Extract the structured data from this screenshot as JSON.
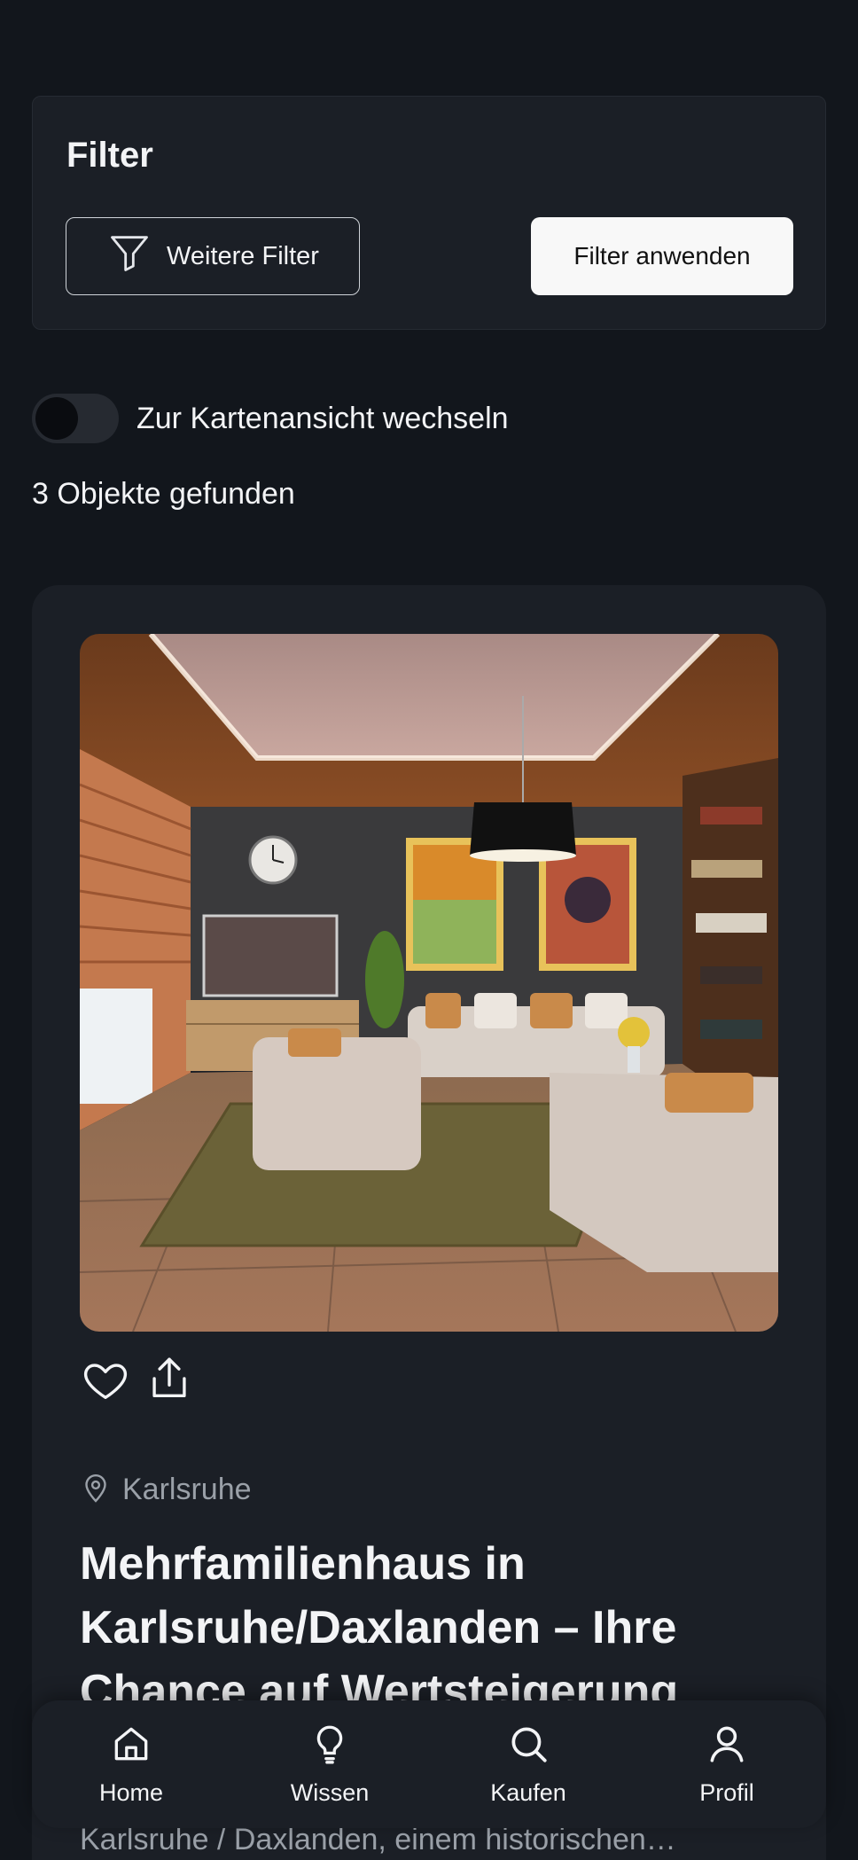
{
  "filter": {
    "title": "Filter",
    "more_filters_label": "Weitere Filter",
    "apply_label": "Filter anwenden"
  },
  "map_toggle": {
    "label": "Zur Kartenansicht wechseln",
    "on": false
  },
  "results": {
    "count_text": "3 Objekte gefunden"
  },
  "listing": {
    "location": "Karlsruhe",
    "title": "Mehrfamilienhaus in Karlsruhe/Daxlanden – Ihre Chance auf Wertsteigerung",
    "description": "Karlsruhe / Daxlanden, einem historischen…",
    "image_alt": "living room"
  },
  "nav": {
    "items": [
      {
        "label": "Home",
        "icon": "home-icon"
      },
      {
        "label": "Wissen",
        "icon": "lightbulb-icon"
      },
      {
        "label": "Kaufen",
        "icon": "search-icon"
      },
      {
        "label": "Profil",
        "icon": "user-icon"
      }
    ]
  },
  "colors": {
    "background": "#12161c",
    "card": "#1b1f26",
    "muted_text": "#9aa0a8",
    "primary_button": "#f8f8f8"
  }
}
